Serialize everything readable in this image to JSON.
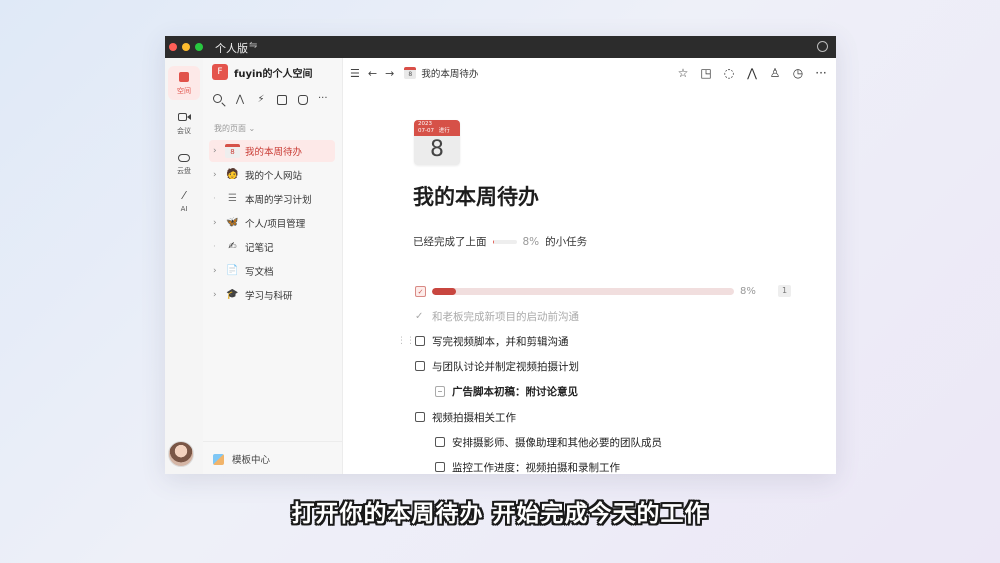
{
  "window": {
    "title": "个人版",
    "switch_glyph": "⇋"
  },
  "rail": [
    {
      "label": "空间",
      "icon": "space-icon",
      "active": true
    },
    {
      "label": "会议",
      "icon": "video-icon",
      "active": false
    },
    {
      "label": "云盘",
      "icon": "cloud-icon",
      "active": false
    },
    {
      "label": "AI",
      "icon": "ai-wand-icon",
      "active": false
    }
  ],
  "sidebar": {
    "workspace_initial": "F",
    "workspace_name": "fuyin的个人空间",
    "section_label": "我的页面 ⌄",
    "items": [
      {
        "label": "我的本周待办",
        "emoji": "8",
        "expand": "›",
        "active": true
      },
      {
        "label": "我的个人网站",
        "emoji": "🧑",
        "expand": "›",
        "active": false
      },
      {
        "label": "本周的学习计划",
        "emoji": "☰",
        "expand": "·",
        "active": false
      },
      {
        "label": "个人/项目管理",
        "emoji": "🦋",
        "expand": "›",
        "active": false
      },
      {
        "label": "记笔记",
        "emoji": "✍",
        "expand": "·",
        "active": false
      },
      {
        "label": "写文档",
        "emoji": "📄",
        "expand": "›",
        "active": false
      },
      {
        "label": "学习与科研",
        "emoji": "🎓",
        "expand": "›",
        "active": false
      }
    ],
    "template_label": "模板中心"
  },
  "topbar": {
    "menu_glyph": "☰",
    "back_glyph": "←",
    "forward_glyph": "→",
    "breadcrumb": "我的本周待办",
    "breadcrumb_icon_text": "8",
    "icons": [
      "☆",
      "◳",
      "◌",
      "⋀",
      "♙",
      "◷",
      "···"
    ]
  },
  "page": {
    "calendar": {
      "year": "2023",
      "date": "07-07",
      "tag": "进行",
      "day": "8"
    },
    "title": "我的本周待办",
    "progress_prefix": "已经完成了上面",
    "progress_pct": "8%",
    "progress_suffix": "的小任务",
    "progress_value": 0.08,
    "task_progress_pct": "8%",
    "task_progress_badge": "1",
    "tasks": [
      {
        "text": "和老板完成新项目的启动前沟通",
        "type": "done"
      },
      {
        "text": "写完视频脚本，并和剪辑沟通",
        "type": "todo"
      },
      {
        "text": "与团队讨论并制定视频拍摄计划",
        "type": "todo"
      },
      {
        "text": "广告脚本初稿：附讨论意见",
        "type": "doc"
      },
      {
        "text": "视频拍摄相关工作",
        "type": "todo"
      },
      {
        "text": "安排摄影师、摄像助理和其他必要的团队成员",
        "type": "todo"
      },
      {
        "text": "监控工作进度：视频拍摄和录制工作",
        "type": "todo"
      }
    ]
  },
  "caption": "打开你的本周待办 开始完成今天的工作",
  "colors": {
    "accent": "#d65148",
    "active_bg": "#fde9e8"
  }
}
